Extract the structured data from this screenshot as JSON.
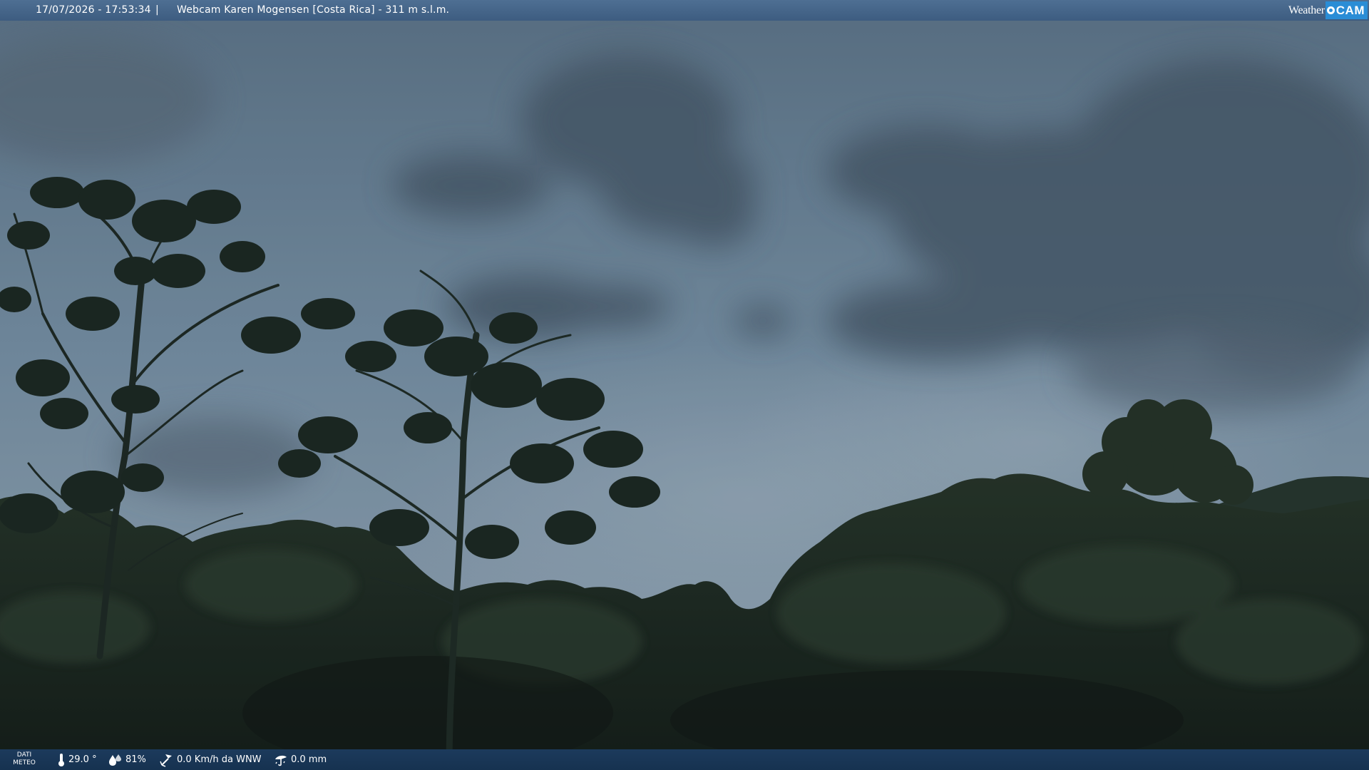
{
  "header": {
    "timestamp": "17/07/2026 - 17:53:34",
    "separator": "|",
    "title": "Webcam Karen Mogensen [Costa Rica] - 311 m s.l.m.",
    "brand": {
      "word": "Weather",
      "cam": "CAM",
      "accent": "#2a8dd6"
    }
  },
  "footer": {
    "meteo_label_1": "DATI",
    "meteo_label_2": "METEO",
    "temperature": "29.0 °",
    "humidity": "81%",
    "wind": "0.0 Km/h da WNW",
    "rain": "0.0 mm",
    "icons": [
      "thermometer-icon",
      "humidity-icon",
      "wind-icon",
      "rain-icon"
    ]
  },
  "colors": {
    "top_bar": "#4e6f93",
    "bottom_bar": "#1c3a5c",
    "sky": "#6f889c",
    "forest": "#1b2a22"
  }
}
